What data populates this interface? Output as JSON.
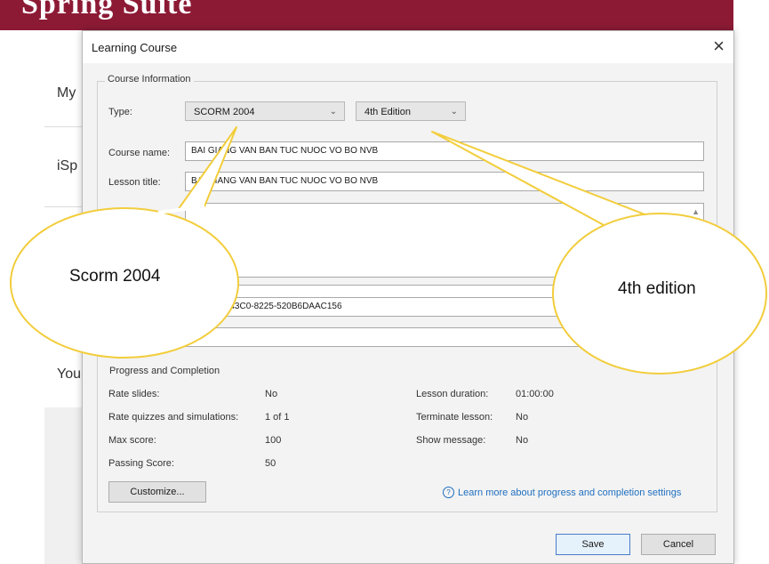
{
  "app": {
    "title": "Spring Suite",
    "side_items": [
      "My",
      "iSp",
      "You"
    ]
  },
  "dialog": {
    "title": "Learning Course",
    "close_glyph": "×"
  },
  "course_info": {
    "legend": "Course Information",
    "type_label": "Type:",
    "type_value": "SCORM 2004",
    "edition_value": "4th Edition",
    "course_name_label": "Course name:",
    "course_name_value": "BAI GIANG VAN BAN TUC NUOC VO BO NVB",
    "lesson_title_label": "Lesson title:",
    "lesson_title_value": "BAI GIANG VAN BAN TUC NUOC VO BO NVB",
    "identifier_partial": "AF-D863-43C0-8225-520B6DAAC156"
  },
  "progress": {
    "legend": "Progress and Completion",
    "rows": [
      {
        "label": "Rate slides:",
        "value": "No"
      },
      {
        "label": "Rate quizzes and simulations:",
        "value": "1 of 1"
      },
      {
        "label": "Max score:",
        "value": "100"
      },
      {
        "label": "Passing Score:",
        "value": "50"
      }
    ],
    "right_rows": [
      {
        "label": "Lesson duration:",
        "value": "01:00:00"
      },
      {
        "label": "Terminate lesson:",
        "value": "No"
      },
      {
        "label": "Show message:",
        "value": "No"
      }
    ],
    "customize_label": "Customize...",
    "learn_more_label": "Learn more about progress and completion settings"
  },
  "footer": {
    "save_label": "Save",
    "cancel_label": "Cancel"
  },
  "callouts": {
    "left_text": "Scorm 2004",
    "right_text": "4th edition"
  },
  "colors": {
    "app_header": "#8c1a35",
    "callout_fill": "#ffffff",
    "callout_stroke": "#f2cd3c",
    "link": "#1f6fc0"
  }
}
